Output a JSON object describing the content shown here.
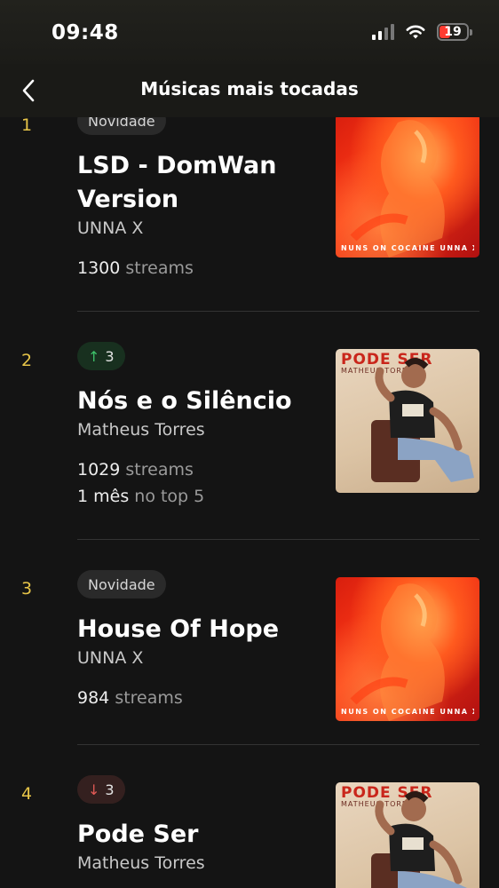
{
  "status_bar": {
    "time": "09:48",
    "battery": "19"
  },
  "header": {
    "title": "Músicas mais tocadas"
  },
  "tracks": [
    {
      "rank": "1",
      "badge": {
        "type": "new",
        "label": "Novidade"
      },
      "title": "LSD - DomWan Version",
      "artist": "UNNA X",
      "streams_value": "1300",
      "streams_unit": "streams",
      "cover": {
        "style": "red",
        "text": "NUNS ON COCAINE  UNNA X"
      }
    },
    {
      "rank": "2",
      "badge": {
        "type": "up",
        "label": "3",
        "icon": "arrow-up-icon"
      },
      "title": "Nós e o Silêncio",
      "artist": "Matheus Torres",
      "streams_value": "1029",
      "streams_unit": "streams",
      "top_value": "1 mês",
      "top_unit": "no top 5",
      "cover": {
        "style": "beige",
        "title": "PODE SER",
        "sub": "MATHEUS TORRES"
      }
    },
    {
      "rank": "3",
      "badge": {
        "type": "new",
        "label": "Novidade"
      },
      "title": "House Of Hope",
      "artist": "UNNA X",
      "streams_value": "984",
      "streams_unit": "streams",
      "cover": {
        "style": "red",
        "text": "NUNS ON COCAINE  UNNA X"
      }
    },
    {
      "rank": "4",
      "badge": {
        "type": "down",
        "label": "3",
        "icon": "arrow-down-icon"
      },
      "title": "Pode Ser",
      "artist": "Matheus Torres",
      "cover": {
        "style": "beige",
        "title": "PODE SER",
        "sub": "MATHEUS TORRES"
      }
    }
  ]
}
